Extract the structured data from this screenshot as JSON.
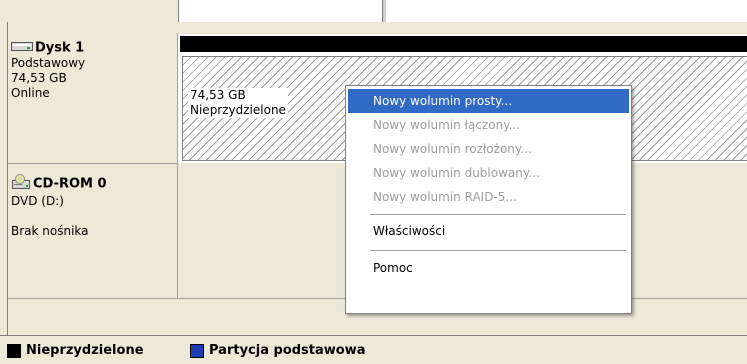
{
  "disks": [
    {
      "title": "Dysk 1",
      "type": "Podstawowy",
      "size": "74,53 GB",
      "status": "Online",
      "icon": "hard-disk-icon",
      "volume": {
        "size": "74,53 GB",
        "label": "Nieprzydzielone"
      }
    },
    {
      "title": "CD-ROM 0",
      "drive": "DVD (D:)",
      "status": "Brak nośnika",
      "icon": "cdrom-icon"
    }
  ],
  "context_menu": {
    "items": [
      {
        "label": "Nowy wolumin prosty...",
        "state": "highlighted"
      },
      {
        "label": "Nowy wolumin łączony...",
        "state": "disabled"
      },
      {
        "label": "Nowy wolumin rozłożony...",
        "state": "disabled"
      },
      {
        "label": "Nowy wolumin dublowany...",
        "state": "disabled"
      },
      {
        "label": "Nowy wolumin RAID-5...",
        "state": "disabled"
      },
      {
        "label": "Właściwości",
        "state": "enabled"
      },
      {
        "label": "Pomoc",
        "state": "enabled"
      }
    ]
  },
  "legend": [
    {
      "label": "Nieprzydzielone",
      "color": "#000000"
    },
    {
      "label": "Partycja podstawowa",
      "color": "#1e3cb4"
    }
  ],
  "colors": {
    "highlight": "#316ac5",
    "volume_bar": "#000000",
    "background": "#ece9d8"
  }
}
